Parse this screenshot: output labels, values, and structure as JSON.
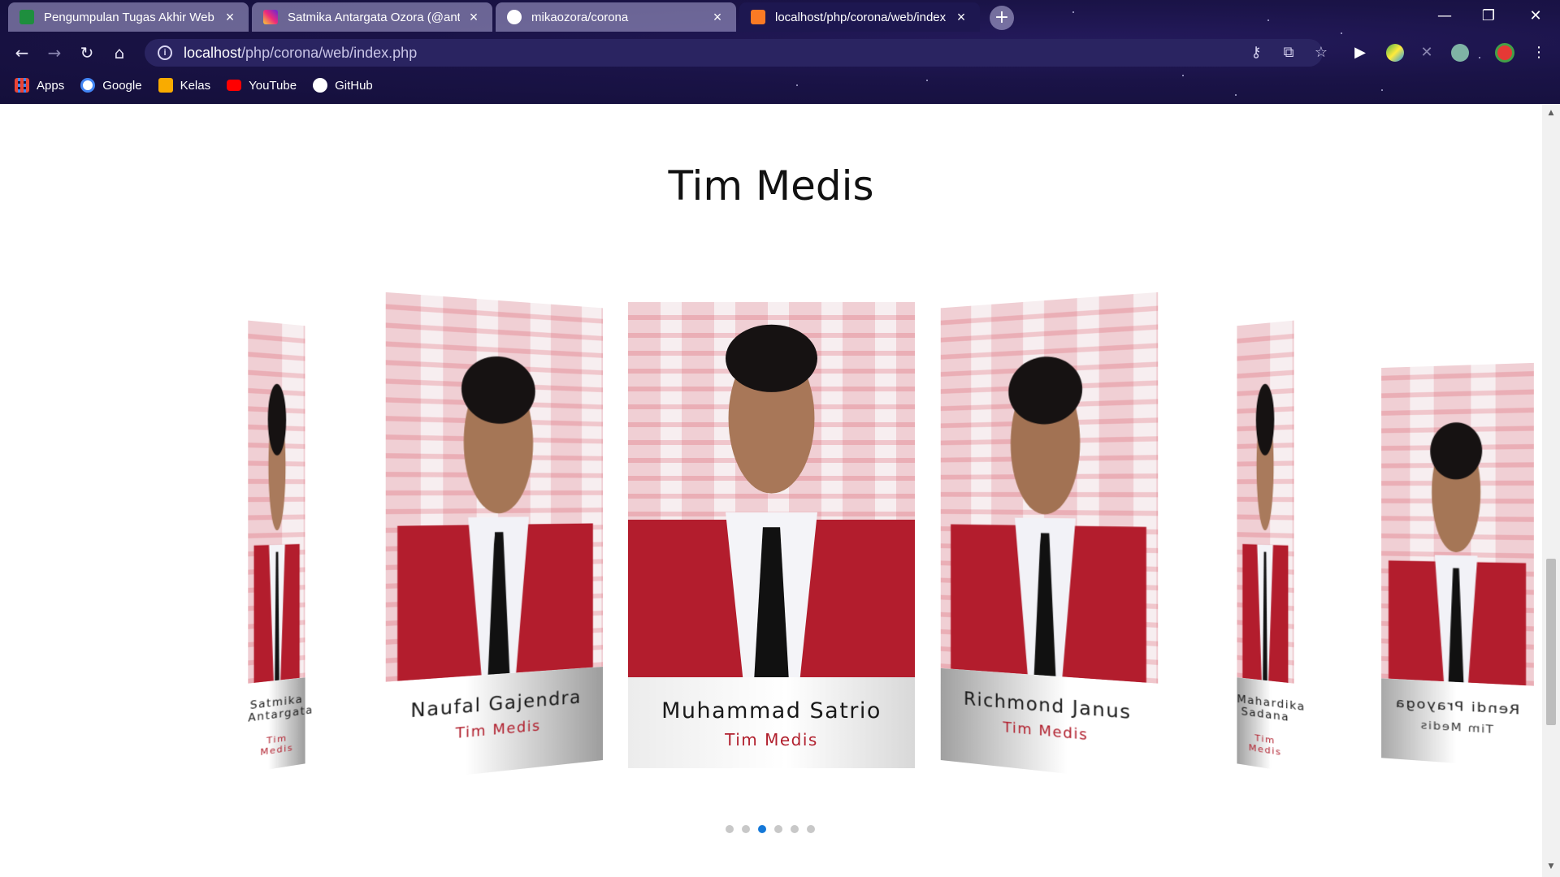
{
  "browser": {
    "tabs": [
      {
        "title": "Pengumpulan Tugas Akhir Web",
        "favicon": "google-classroom-icon",
        "color": "#1e8e3e"
      },
      {
        "title": "Satmika Antargata Ozora (@anta",
        "favicon": "instagram-icon",
        "color": "#d6249f"
      },
      {
        "title": "mikaozora/corona",
        "favicon": "github-icon",
        "color": "#ffffff"
      },
      {
        "title": "localhost/php/corona/web/index",
        "favicon": "xampp-icon",
        "color": "#fb7a24"
      }
    ],
    "active_tab": 3,
    "new_tab_label": "+",
    "window_controls": {
      "minimize": "—",
      "maximize": "❐",
      "close": "✕"
    },
    "url": {
      "host": "localhost",
      "path": "/php/corona/web/index.php"
    },
    "bookmarks": [
      {
        "label": "Apps",
        "icon": "apps-grid-icon"
      },
      {
        "label": "Google",
        "icon": "google-icon"
      },
      {
        "label": "Kelas",
        "icon": "google-classroom-icon"
      },
      {
        "label": "YouTube",
        "icon": "youtube-icon"
      },
      {
        "label": "GitHub",
        "icon": "github-icon"
      }
    ]
  },
  "section": {
    "title": "Tim Medis"
  },
  "carousel": {
    "cards": [
      {
        "name": "Satmika Antargata",
        "role": "Tim Medis"
      },
      {
        "name": "Naufal Gajendra",
        "role": "Tim Medis"
      },
      {
        "name": "Muhammad Satrio",
        "role": "Tim Medis"
      },
      {
        "name": "Richmond Janus",
        "role": "Tim Medis"
      },
      {
        "name": "Mahardika Sadana",
        "role": "Tim Medis"
      },
      {
        "name": "Rendi Prayoga",
        "role": "Tim Medis"
      }
    ],
    "active_index": 2,
    "dot_count": 6,
    "accent_color": "#b1202e",
    "dot_active_color": "#1478d8"
  }
}
